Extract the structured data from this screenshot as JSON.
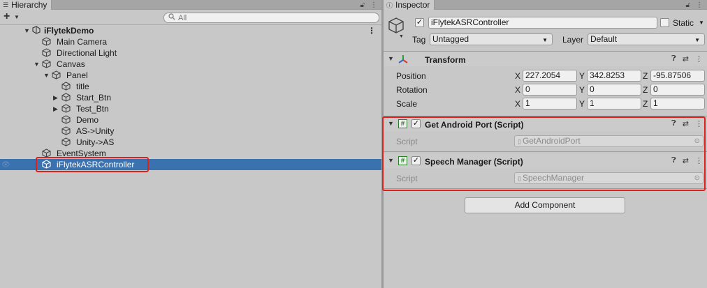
{
  "hierarchy": {
    "tab_label": "Hierarchy",
    "search_placeholder": "All",
    "scene": "iFlytekDemo",
    "items": [
      {
        "label": "Main Camera"
      },
      {
        "label": "Directional Light"
      },
      {
        "label": "Canvas"
      },
      {
        "label": "Panel"
      },
      {
        "label": "title"
      },
      {
        "label": "Start_Btn"
      },
      {
        "label": "Test_Btn"
      },
      {
        "label": "Demo"
      },
      {
        "label": "AS->Unity"
      },
      {
        "label": "Unity->AS"
      },
      {
        "label": "EventSystem"
      },
      {
        "label": "iFlytekASRController"
      }
    ]
  },
  "inspector": {
    "tab_label": "Inspector",
    "object_name": "iFlytekASRController",
    "static_label": "Static",
    "tag_label": "Tag",
    "tag_value": "Untagged",
    "layer_label": "Layer",
    "layer_value": "Default",
    "transform": {
      "title": "Transform",
      "position_label": "Position",
      "rotation_label": "Rotation",
      "scale_label": "Scale",
      "axis_x": "X",
      "axis_y": "Y",
      "axis_z": "Z",
      "position": {
        "x": "227.2054",
        "y": "342.8253",
        "z": "-95.87506"
      },
      "rotation": {
        "x": "0",
        "y": "0",
        "z": "0"
      },
      "scale": {
        "x": "1",
        "y": "1",
        "z": "1"
      }
    },
    "components": [
      {
        "title": "Get Android Port (Script)",
        "script_label": "Script",
        "script_value": "GetAndroidPort"
      },
      {
        "title": "Speech Manager (Script)",
        "script_label": "Script",
        "script_value": "SpeechManager"
      }
    ],
    "add_component_label": "Add Component"
  },
  "colors": {
    "panel_bg": "#c8c8c8",
    "selection": "#3a72b0",
    "highlight_box": "#e0211b"
  }
}
